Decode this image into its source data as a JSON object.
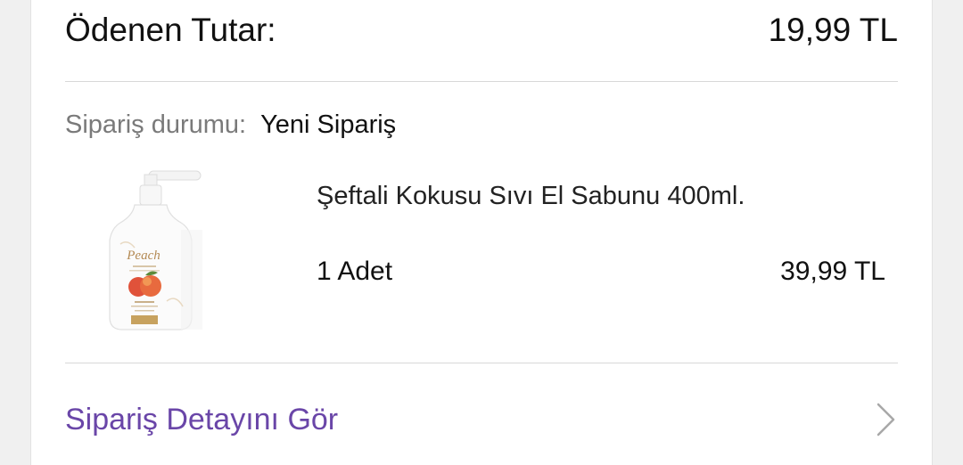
{
  "summary": {
    "paid_label": "Ödenen Tutar:",
    "paid_value": "19,99 TL"
  },
  "order": {
    "status_label": "Sipariş durumu:",
    "status_value": "Yeni Sipariş"
  },
  "product": {
    "name": "Şeftali Kokusu Sıvı El Sabunu 400ml.",
    "quantity": "1 Adet",
    "price": "39,99 TL",
    "image_brand_text": "Peach"
  },
  "actions": {
    "detail_link": "Sipariş Detayını Gör"
  },
  "icons": {
    "chevron": "chevron-right-icon"
  },
  "colors": {
    "link": "#6a46a8",
    "status_label": "#7a7a7a"
  }
}
